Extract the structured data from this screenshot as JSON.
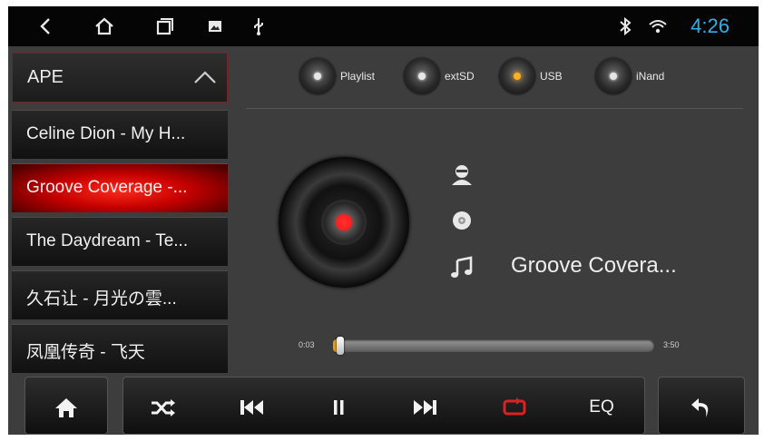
{
  "status_bar": {
    "time": "4:26",
    "left_icons": [
      "back-icon",
      "home-icon",
      "recent-apps-icon",
      "image-icon",
      "usb-icon"
    ],
    "right_icons": [
      "bluetooth-icon",
      "wifi-icon"
    ],
    "accent_color": "#2fb1e8"
  },
  "playlist": {
    "header": "APE",
    "items": [
      {
        "label": "Celine Dion - My H..."
      },
      {
        "label": "Groove Coverage -..."
      },
      {
        "label": "The Daydream - Te..."
      },
      {
        "label": "久石让 - 月光の雲..."
      },
      {
        "label": "凤凰传奇 - 飞天"
      }
    ],
    "active_index": 1
  },
  "sources": [
    {
      "label": "Playlist",
      "active": false
    },
    {
      "label": "extSD",
      "active": false
    },
    {
      "label": "USB",
      "active": true
    },
    {
      "label": "iNand",
      "active": false
    }
  ],
  "now_playing": {
    "title": "Groove Covera...",
    "icons": [
      "artist-icon",
      "album-icon",
      "music-note-icon"
    ]
  },
  "progress": {
    "elapsed": "0:03",
    "total": "3:50",
    "fraction": 0.013
  },
  "controls": {
    "home_icon": "home-icon",
    "shuffle_icon": "shuffle-icon",
    "previous_icon": "previous-icon",
    "pause_icon": "pause-icon",
    "next_icon": "next-icon",
    "repeat_icon": "repeat-icon",
    "eq_label": "EQ",
    "back_icon": "return-icon",
    "repeat_color": "#e02020"
  }
}
